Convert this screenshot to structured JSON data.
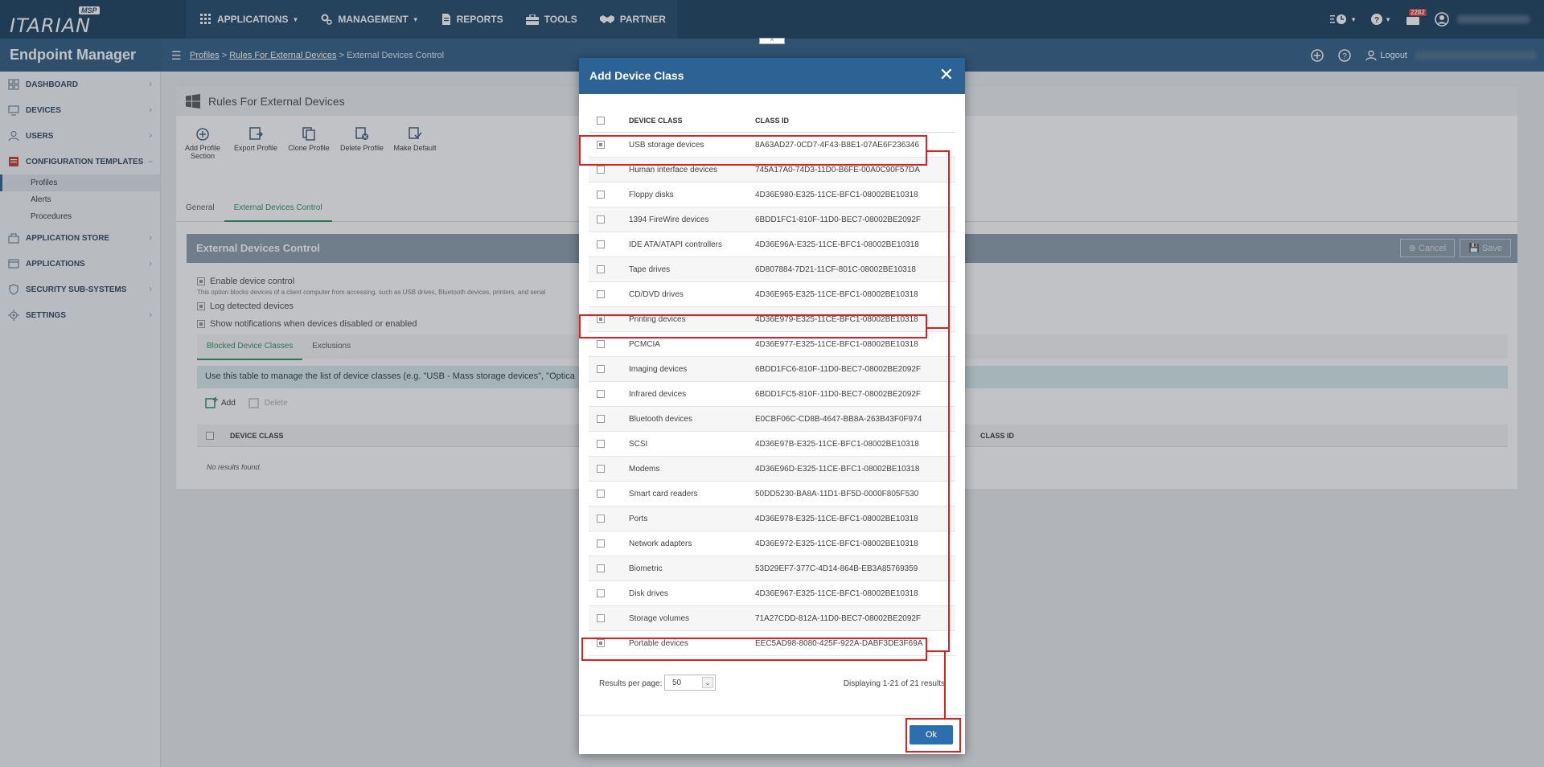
{
  "brand": {
    "logo_word": "ITARIAN",
    "logo_badge": "MSP"
  },
  "topnav": {
    "applications": "APPLICATIONS",
    "management": "MANAGEMENT",
    "reports": "REPORTS",
    "tools": "TOOLS",
    "partner": "PARTNER"
  },
  "topright": {
    "notification_count": "2282"
  },
  "subbar": {
    "app_title": "Endpoint Manager",
    "breadcrumb": [
      "Profiles",
      "Rules For External Devices",
      "External Devices Control"
    ],
    "logout": "Logout"
  },
  "sidebar": {
    "items": [
      {
        "label": "DASHBOARD"
      },
      {
        "label": "DEVICES"
      },
      {
        "label": "USERS"
      },
      {
        "label": "CONFIGURATION TEMPLATES"
      },
      {
        "label": "APPLICATION STORE"
      },
      {
        "label": "APPLICATIONS"
      },
      {
        "label": "SECURITY SUB-SYSTEMS"
      },
      {
        "label": "SETTINGS"
      }
    ],
    "subitems": [
      "Profiles",
      "Alerts",
      "Procedures"
    ]
  },
  "main": {
    "title": "Rules For External Devices",
    "toolbar": [
      "Add Profile Section",
      "Export Profile",
      "Clone Profile",
      "Delete Profile",
      "Make Default"
    ],
    "tabs": [
      "General",
      "External Devices Control"
    ],
    "section_title": "External Devices Control",
    "cancel": "Cancel",
    "save": "Save",
    "options": {
      "enable": "Enable device control",
      "enable_desc": "This option blocks devices of a client computer from accessing, such as USB drives, Bluetooth devices, printers, and serial",
      "log": "Log detected devices",
      "notify": "Show notifications when devices disabled or enabled"
    },
    "inner_tabs": [
      "Blocked Device Classes",
      "Exclusions"
    ],
    "info": "Use this table to manage the list of device classes (e.g. \"USB - Mass storage devices\", \"Optica",
    "add": "Add",
    "delete": "Delete",
    "col_device_class": "DEVICE CLASS",
    "col_class_id": "CLASS ID",
    "no_results": "No results found."
  },
  "modal": {
    "title": "Add Device Class",
    "col_device_class": "DEVICE CLASS",
    "col_class_id": "CLASS ID",
    "rows": [
      {
        "name": "USB storage devices",
        "id": "8A63AD27-0CD7-4F43-B8E1-07AE6F236346",
        "checked": true
      },
      {
        "name": "Human interface devices",
        "id": "745A17A0-74D3-11D0-B6FE-00A0C90F57DA",
        "checked": false
      },
      {
        "name": "Floppy disks",
        "id": "4D36E980-E325-11CE-BFC1-08002BE10318",
        "checked": false
      },
      {
        "name": "1394 FireWire devices",
        "id": "6BDD1FC1-810F-11D0-BEC7-08002BE2092F",
        "checked": false
      },
      {
        "name": "IDE ATA/ATAPI controllers",
        "id": "4D36E96A-E325-11CE-BFC1-08002BE10318",
        "checked": false
      },
      {
        "name": "Tape drives",
        "id": "6D807884-7D21-11CF-801C-08002BE10318",
        "checked": false
      },
      {
        "name": "CD/DVD drives",
        "id": "4D36E965-E325-11CE-BFC1-08002BE10318",
        "checked": false
      },
      {
        "name": "Printing devices",
        "id": "4D36E979-E325-11CE-BFC1-08002BE10318",
        "checked": true
      },
      {
        "name": "PCMCIA",
        "id": "4D36E977-E325-11CE-BFC1-08002BE10318",
        "checked": false
      },
      {
        "name": "Imaging devices",
        "id": "6BDD1FC6-810F-11D0-BEC7-08002BE2092F",
        "checked": false
      },
      {
        "name": "Infrared devices",
        "id": "6BDD1FC5-810F-11D0-BEC7-08002BE2092F",
        "checked": false
      },
      {
        "name": "Bluetooth devices",
        "id": "E0CBF06C-CD8B-4647-BB8A-263B43F0F974",
        "checked": false
      },
      {
        "name": "SCSI",
        "id": "4D36E97B-E325-11CE-BFC1-08002BE10318",
        "checked": false
      },
      {
        "name": "Modems",
        "id": "4D36E96D-E325-11CE-BFC1-08002BE10318",
        "checked": false
      },
      {
        "name": "Smart card readers",
        "id": "50DD5230-BA8A-11D1-BF5D-0000F805F530",
        "checked": false
      },
      {
        "name": "Ports",
        "id": "4D36E978-E325-11CE-BFC1-08002BE10318",
        "checked": false
      },
      {
        "name": "Network adapters",
        "id": "4D36E972-E325-11CE-BFC1-08002BE10318",
        "checked": false
      },
      {
        "name": "Biometric",
        "id": "53D29EF7-377C-4D14-864B-EB3A85769359",
        "checked": false
      },
      {
        "name": "Disk drives",
        "id": "4D36E967-E325-11CE-BFC1-08002BE10318",
        "checked": false
      },
      {
        "name": "Storage volumes",
        "id": "71A27CDD-812A-11D0-BEC7-08002BE2092F",
        "checked": false
      },
      {
        "name": "Portable devices",
        "id": "EEC5AD98-8080-425F-922A-DABF3DE3F69A",
        "checked": true
      }
    ],
    "results_label": "Results per page:",
    "results_value": "50",
    "displaying": "Displaying 1-21 of 21 results",
    "ok": "Ok"
  },
  "colors": {
    "topbar": "#143a5a",
    "modal_header": "#2d6295",
    "accent_green": "#2c8c5c",
    "annotation_red": "#e02020"
  }
}
